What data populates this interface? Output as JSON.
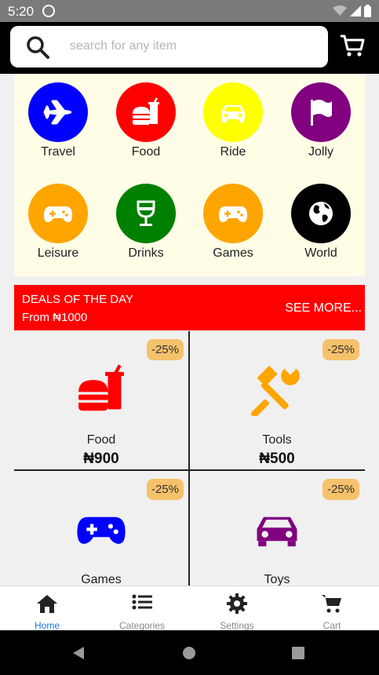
{
  "status_bar": {
    "time": "5:20"
  },
  "header": {
    "search_placeholder": "search for any item"
  },
  "categories": [
    {
      "label": "Travel",
      "color": "#0000ff",
      "icon": "airplane-icon"
    },
    {
      "label": "Food",
      "color": "#ff0000",
      "icon": "hamburger-soda-icon"
    },
    {
      "label": "Ride",
      "color": "#ffff00",
      "icon": "car-icon"
    },
    {
      "label": "Jolly",
      "color": "#800080",
      "icon": "flag-icon"
    },
    {
      "label": "Leisure",
      "color": "#ffa500",
      "icon": "gamepad-icon"
    },
    {
      "label": "Drinks",
      "color": "#008000",
      "icon": "wine-glass-icon"
    },
    {
      "label": "Games",
      "color": "#ffa500",
      "icon": "gamepad-icon"
    },
    {
      "label": "World",
      "color": "#000000",
      "icon": "globe-icon"
    }
  ],
  "deals": {
    "title": "DEALS OF THE DAY",
    "subtitle": "From ₦1000",
    "see_more": "SEE MORE...",
    "items": [
      {
        "name": "Food",
        "price": "₦900",
        "discount": "-25%",
        "icon": "hamburger-soda-icon",
        "color": "#ff0000"
      },
      {
        "name": "Tools",
        "price": "₦500",
        "discount": "-25%",
        "icon": "tools-icon",
        "color": "#ffa500"
      },
      {
        "name": "Games",
        "price": "",
        "discount": "-25%",
        "icon": "gamepad-icon",
        "color": "#0000ff"
      },
      {
        "name": "Toys",
        "price": "",
        "discount": "-25%",
        "icon": "car-icon",
        "color": "#800080"
      }
    ]
  },
  "bottom_nav": [
    {
      "label": "Home",
      "icon": "home-icon",
      "active": true
    },
    {
      "label": "Categories",
      "icon": "list-icon",
      "active": false
    },
    {
      "label": "Settings",
      "icon": "gear-icon",
      "active": false
    },
    {
      "label": "Cart",
      "icon": "cart-icon",
      "active": false
    }
  ],
  "colors": {
    "accent": "#ff0000",
    "nav_active": "#1a73e8",
    "panel_bg": "#fffde6",
    "discount_bg": "#f5c26b"
  }
}
